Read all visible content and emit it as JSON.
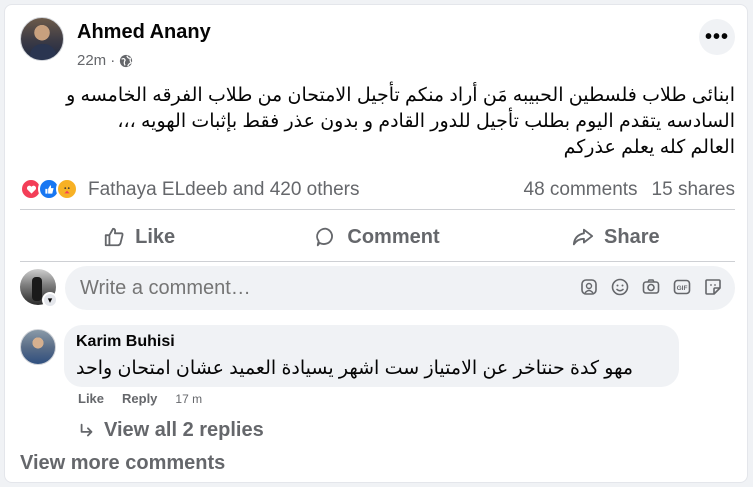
{
  "post": {
    "author": "Ahmed Anany",
    "time": "22m",
    "separator": "·",
    "audience_icon": "globe-icon",
    "more_label": "•••",
    "text_lines": [
      "ابنائى طلاب فلسطين الحبيبه مَن أراد منكم تأجيل الامتحان من طلاب الفرقه الخامسه و",
      "السادسه يتقدم اليوم بطلب تأجيل للدور القادم  و بدون عذر فقط بإثبات الهويه ،،،",
      "العالم كله يعلم عذركم"
    ]
  },
  "reactions": {
    "icons": [
      "love-reaction-icon",
      "like-reaction-icon",
      "care-reaction-icon"
    ],
    "summary": "Fathaya ELdeeb and 420 others",
    "comments": "48 comments",
    "shares": "15 shares"
  },
  "actions": {
    "like": "Like",
    "comment": "Comment",
    "share": "Share"
  },
  "composer": {
    "placeholder": "Write a comment…",
    "icons": [
      "avatar-sticker-icon",
      "emoji-icon",
      "camera-icon",
      "gif-icon",
      "sticker-icon"
    ]
  },
  "comment": {
    "author": "Karim Buhisi",
    "text": "مهو كدة حنتاخر عن الامتياز ست اشهر يسيادة العميد عشان امتحان واحد",
    "like": "Like",
    "reply": "Reply",
    "time": "17 m",
    "view_replies": "View all 2 replies"
  },
  "footer": {
    "view_more": "View more comments"
  },
  "colors": {
    "secondary_text": "#65676b",
    "bubble_bg": "#f0f2f5",
    "like_blue": "#1877f2",
    "love_red": "#f33e58",
    "care_yellow": "#f7b125"
  }
}
